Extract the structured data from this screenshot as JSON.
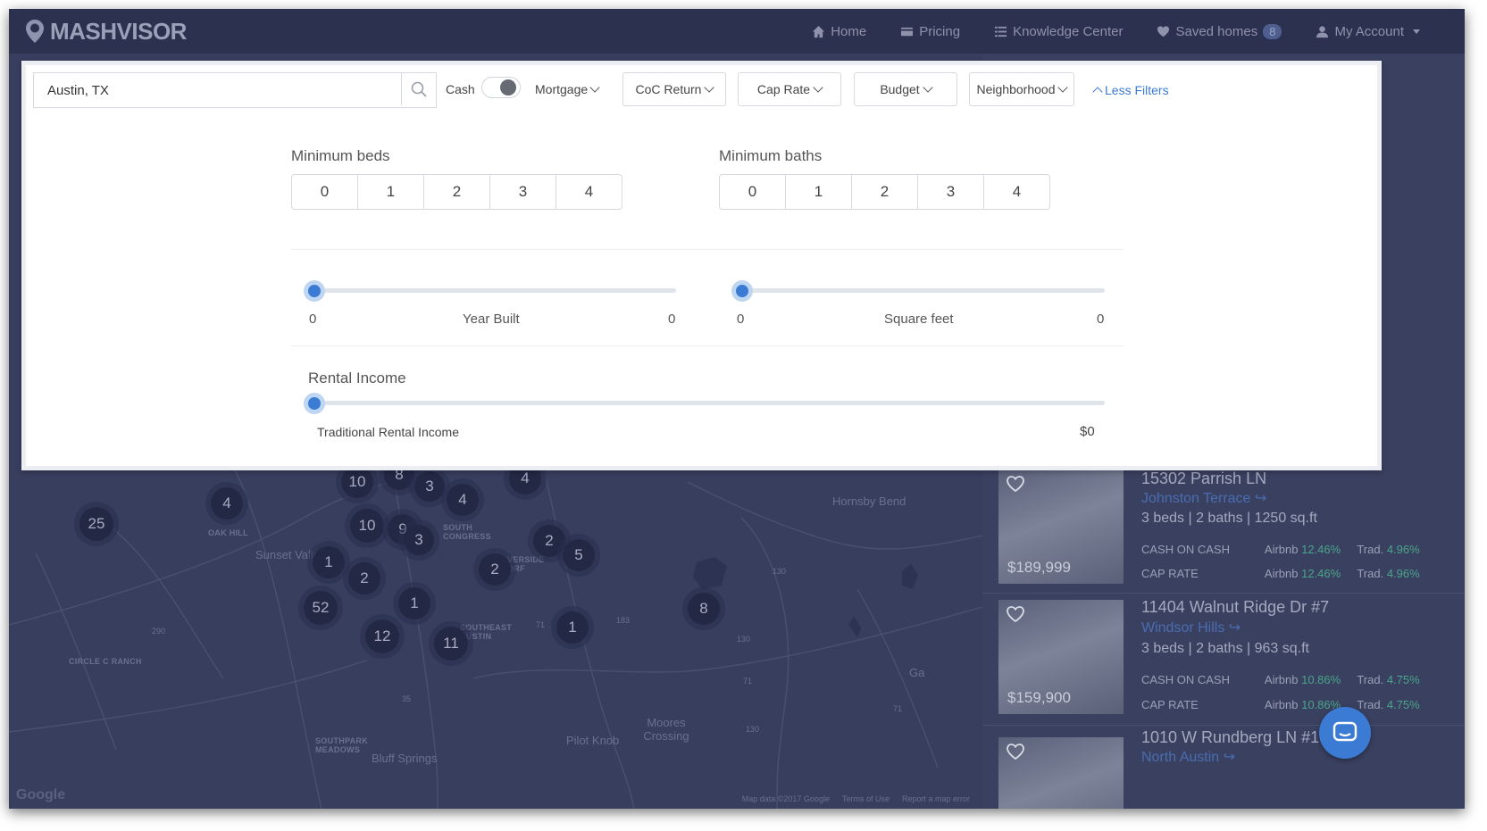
{
  "brand": {
    "name": "MASHVISOR"
  },
  "nav": {
    "home": "Home",
    "pricing": "Pricing",
    "knowledge": "Knowledge Center",
    "saved": "Saved homes",
    "saved_count": "8",
    "account": "My Account"
  },
  "filters": {
    "location_value": "Austin, TX",
    "cash_label": "Cash",
    "mortgage_label": "Mortgage",
    "coc_label": "CoC Return",
    "cap_label": "Cap Rate",
    "budget_label": "Budget",
    "neighborhood_label": "Neighborhood",
    "less_filters": "Less Filters",
    "min_beds_label": "Minimum beds",
    "min_baths_label": "Minimum baths",
    "bed_options": [
      "0",
      "1",
      "2",
      "3",
      "4"
    ],
    "bath_options": [
      "0",
      "1",
      "2",
      "3",
      "4"
    ],
    "year_built": {
      "label": "Year Built",
      "min": "0",
      "max": "0",
      "value_fraction": 0
    },
    "square_feet": {
      "label": "Square feet",
      "min": "0",
      "max": "0",
      "value_fraction": 0
    },
    "rental_income": {
      "label": "Rental Income",
      "sub_label": "Traditional Rental Income",
      "value": "$0",
      "value_fraction": 0
    }
  },
  "map": {
    "clusters": [
      "25",
      "4",
      "10",
      "8",
      "3",
      "4",
      "4",
      "10",
      "9",
      "3",
      "2",
      "5",
      "1",
      "2",
      "2",
      "52",
      "1",
      "12",
      "11",
      "1",
      "8"
    ],
    "labels": {
      "oak_hill": "OAK HILL",
      "sunset_valley": "Sunset Valley",
      "south_congress": "SOUTH CONGRESS",
      "riverside": "VERSIDE ORF",
      "southeast_austin": "SOUTHEAST AUSTIN",
      "circle_c": "CIRCLE C RANCH",
      "southpark": "SOUTHPARK MEADOWS",
      "bluff_springs": "Bluff Springs",
      "pilot_knob": "Pilot Knob",
      "moores_crossing": "Moores Crossing",
      "hornsby_bend": "Hornsby Bend",
      "ga": "Ga"
    },
    "footer": {
      "data": "Map data ©2017 Google",
      "terms": "Terms of Use",
      "report": "Report a map error"
    },
    "google": "Google"
  },
  "listings": [
    {
      "address": "15302 Parrish LN",
      "neighborhood": "Johnston Terrace",
      "specs": "3 beds | 2 baths | 1250 sq.ft",
      "price": "$189,999",
      "coc_label": "CASH ON CASH",
      "coc_airbnb_label": "Airbnb",
      "coc_airbnb": "12.46%",
      "coc_trad_label": "Trad.",
      "coc_trad": "4.96%",
      "cap_label": "CAP RATE",
      "cap_airbnb_label": "Airbnb",
      "cap_airbnb": "12.46%",
      "cap_trad_label": "Trad.",
      "cap_trad": "4.96%"
    },
    {
      "address": "11404 Walnut Ridge Dr #7",
      "neighborhood": "Windsor Hills",
      "specs": "3 beds | 2 baths | 963 sq.ft",
      "price": "$159,900",
      "coc_label": "CASH ON CASH",
      "coc_airbnb_label": "Airbnb",
      "coc_airbnb": "10.86%",
      "coc_trad_label": "Trad.",
      "coc_trad": "4.75%",
      "cap_label": "CAP RATE",
      "cap_airbnb_label": "Airbnb",
      "cap_airbnb": "10.86%",
      "cap_trad_label": "Trad.",
      "cap_trad": "4.75%"
    },
    {
      "address": "1010 W Rundberg LN #18",
      "neighborhood": "North Austin"
    }
  ],
  "colors": {
    "accent": "#3b7bd4",
    "overlay_nav": "#2c3150",
    "green": "#4aa58a"
  }
}
